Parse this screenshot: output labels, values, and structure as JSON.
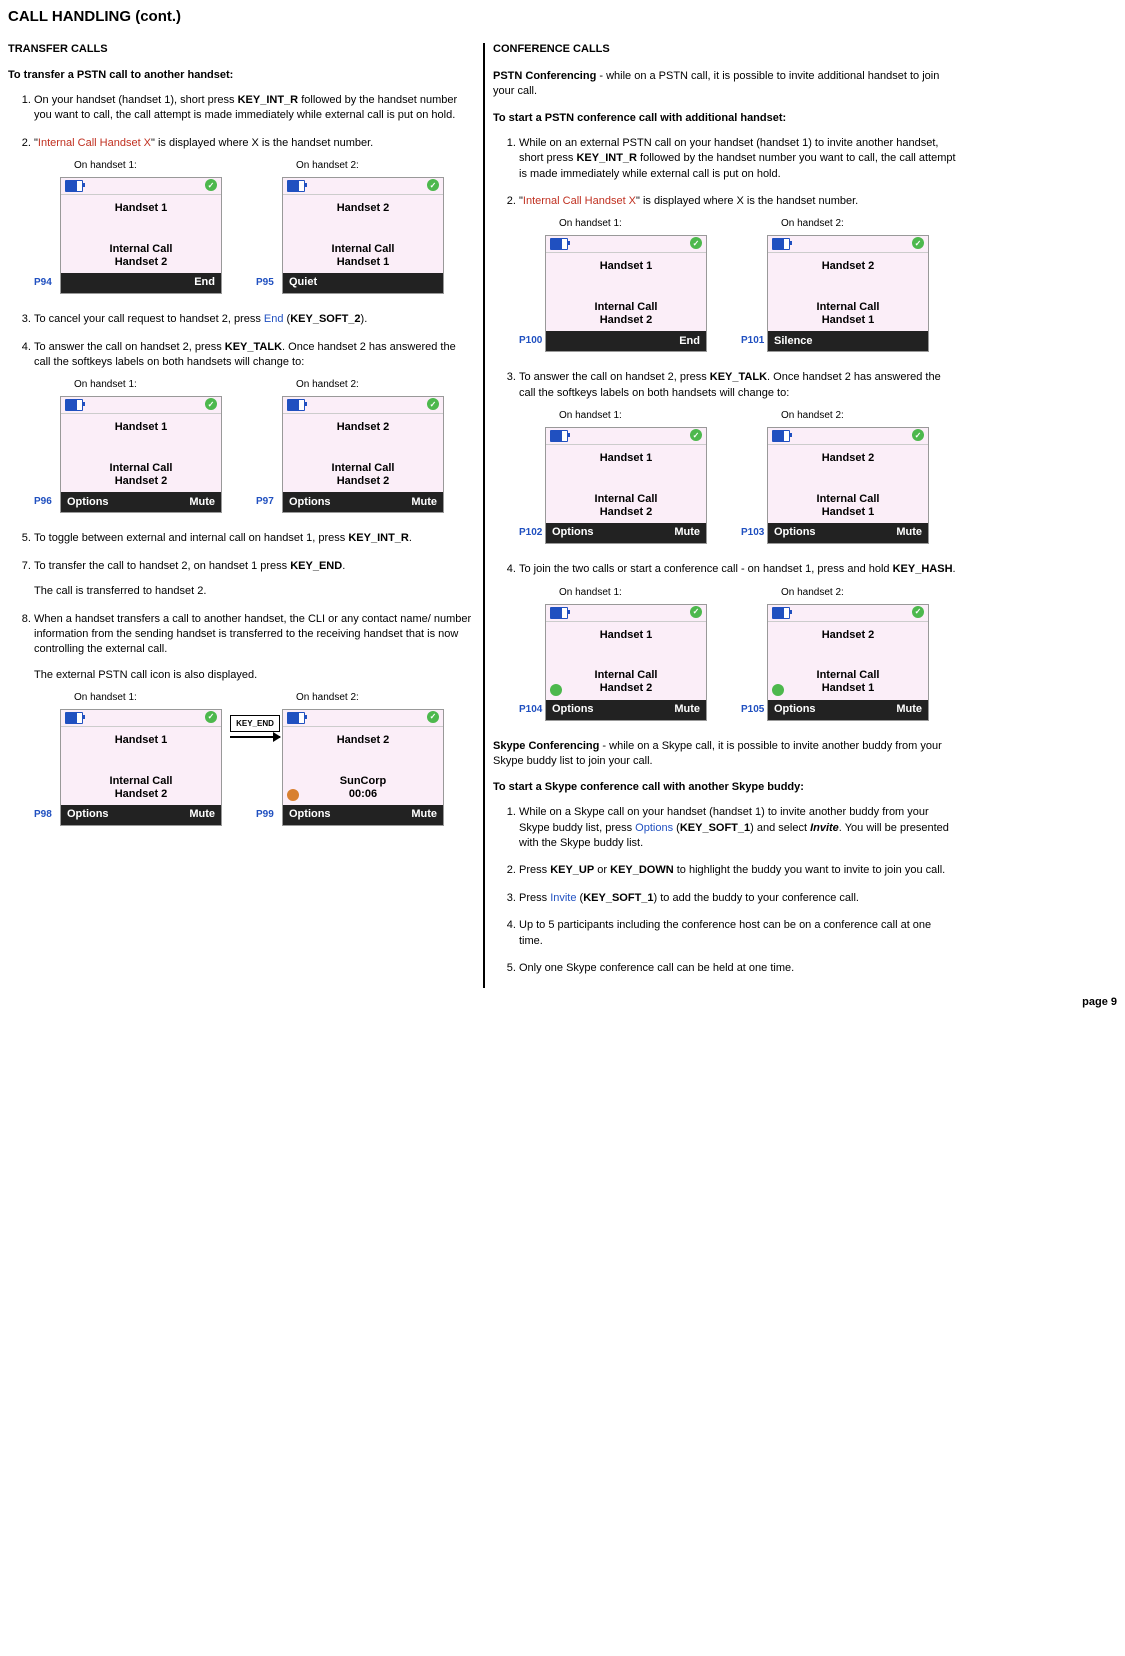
{
  "title": "CALL HANDLING (cont.)",
  "page_num": "page 9",
  "left": {
    "h2": "TRANSFER CALLS",
    "h3": "To transfer a PSTN call to another handset:",
    "step1_a": "On your handset (handset 1), short press ",
    "step1_b": "KEY_INT_R",
    "step1_c": " followed by the handset number you want to call, the call attempt is made immediately while external call is put on hold.",
    "step2_a": "\"",
    "step2_red": "Internal Call Handset X",
    "step2_b": "\" is displayed where X is the handset number.",
    "cap_h1": "On handset 1:",
    "cap_h2": "On handset 2:",
    "p94": {
      "id": "P94",
      "name": "Handset    1",
      "l1": "Internal Call",
      "l2": "Handset 2",
      "sk_l": "",
      "sk_r": "End"
    },
    "p95": {
      "id": "P95",
      "name": "Handset    2",
      "l1": "Internal Call",
      "l2": "Handset 1",
      "sk": "Quiet"
    },
    "step3_a": "To cancel your call request to handset 2, press ",
    "step3_blue": "End",
    "step3_b": " (",
    "step3_key": "KEY_SOFT_2",
    "step3_c": ").",
    "step4_a": "To answer the call on handset 2, press ",
    "step4_key": "KEY_TALK",
    "step4_b": ". Once handset 2 has answered the call the softkeys labels on both handsets will change to:",
    "p96": {
      "id": "P96",
      "name": "Handset    1",
      "l1": "Internal Call",
      "l2": "Handset 2",
      "sk_l": "Options",
      "sk_r": "Mute"
    },
    "p97": {
      "id": "P97",
      "name": "Handset    2",
      "l1": "Internal Call",
      "l2": "Handset 2",
      "sk_l": "Options",
      "sk_r": "Mute"
    },
    "step5_a": "To toggle between external and internal call on handset 1, press ",
    "step5_key": "KEY_INT_R",
    "step5_b": ".",
    "step7_a": "To transfer the call to handset 2, on handset 1 press ",
    "step7_key": "KEY_END",
    "step7_b": ".",
    "step7_sub": "The call is transferred to handset 2.",
    "step8": "When a handset transfers a call to another handset, the CLI or any contact name/ number information from the sending handset is transferred to the receiving handset that is now controlling the external call.",
    "step8_sub": "The external PSTN call icon is also displayed.",
    "p98": {
      "id": "P98",
      "name": "Handset    1",
      "l1": "Internal Call",
      "l2": "Handset 2",
      "sk_l": "Options",
      "sk_r": "Mute"
    },
    "p99": {
      "id": "P99",
      "name": "Handset    2",
      "l1": "SunCorp",
      "l2": "00:06",
      "sk_l": "Options",
      "sk_r": "Mute"
    },
    "arrow_label": "KEY_END"
  },
  "right": {
    "h2": "CONFERENCE CALLS",
    "pstn_a": "PSTN Conferencing",
    "pstn_b": " - while on a PSTN call, it is possible to invite additional handset to join your call.",
    "h3a": "To start a PSTN conference call with additional handset:",
    "step1_a": "While on an external PSTN call on your handset (handset 1) to invite another handset, short press ",
    "step1_key": "KEY_INT_R",
    "step1_b": " followed by the handset number you want to call, the call attempt is made immediately while external call is put on hold.",
    "step2_a": "\"",
    "step2_red": "Internal Call Handset X",
    "step2_b": "\" is displayed where X is the handset number.",
    "cap_h1": "On handset 1:",
    "cap_h2": "On handset 2:",
    "p100": {
      "id": "P100",
      "name": "Handset    1",
      "l1": "Internal Call",
      "l2": "Handset 2",
      "sk_l": "",
      "sk_r": "End"
    },
    "p101": {
      "id": "P101",
      "name": "Handset    2",
      "l1": "Internal Call",
      "l2": "Handset 1",
      "sk": "Silence"
    },
    "step3_a": "To answer the call on handset 2, press ",
    "step3_key": "KEY_TALK",
    "step3_b": ". Once handset 2 has answered the call the softkeys labels on both handsets will change to:",
    "p102": {
      "id": "P102",
      "name": "Handset    1",
      "l1": "Internal Call",
      "l2": "Handset 2",
      "sk_l": "Options",
      "sk_r": "Mute"
    },
    "p103": {
      "id": "P103",
      "name": "Handset    2",
      "l1": "Internal Call",
      "l2": "Handset 1",
      "sk_l": "Options",
      "sk_r": "Mute"
    },
    "step4_a": "To join the two calls or start a conference call - on handset 1, press and hold ",
    "step4_key": "KEY_HASH",
    "step4_b": ".",
    "p104": {
      "id": "P104",
      "name": "Handset    1",
      "l1": "Internal Call",
      "l2": "Handset 2",
      "sk_l": "Options",
      "sk_r": "Mute"
    },
    "p105": {
      "id": "P105",
      "name": "Handset    2",
      "l1": "Internal Call",
      "l2": "Handset 1",
      "sk_l": "Options",
      "sk_r": "Mute"
    },
    "skype_a": "Skype Conferencing",
    "skype_b": " - while on a Skype call, it is possible to invite another buddy from your Skype buddy list to join your call.",
    "h3b": "To start a Skype conference call with another Skype buddy:",
    "s1_a": "While on a Skype call on your handset (handset 1) to invite another buddy from your Skype buddy list, press ",
    "s1_blue": "Options",
    "s1_b": " (",
    "s1_key": "KEY_SOFT_1",
    "s1_c": ") and select ",
    "s1_i": "Invite",
    "s1_d": ". You will be presented with the Skype buddy list.",
    "s2_a": "Press ",
    "s2_k1": "KEY_UP",
    "s2_b": " or ",
    "s2_k2": "KEY_DOWN",
    "s2_c": " to highlight the buddy you want to invite to join you call.",
    "s3_a": "Press ",
    "s3_blue": "Invite",
    "s3_b": " (",
    "s3_key": "KEY_SOFT_1",
    "s3_c": ") to add the buddy to your conference call.",
    "s4": "Up to 5 participants including the conference host can be on a conference call at one time.",
    "s5": "Only one Skype conference call can be held at one time."
  }
}
